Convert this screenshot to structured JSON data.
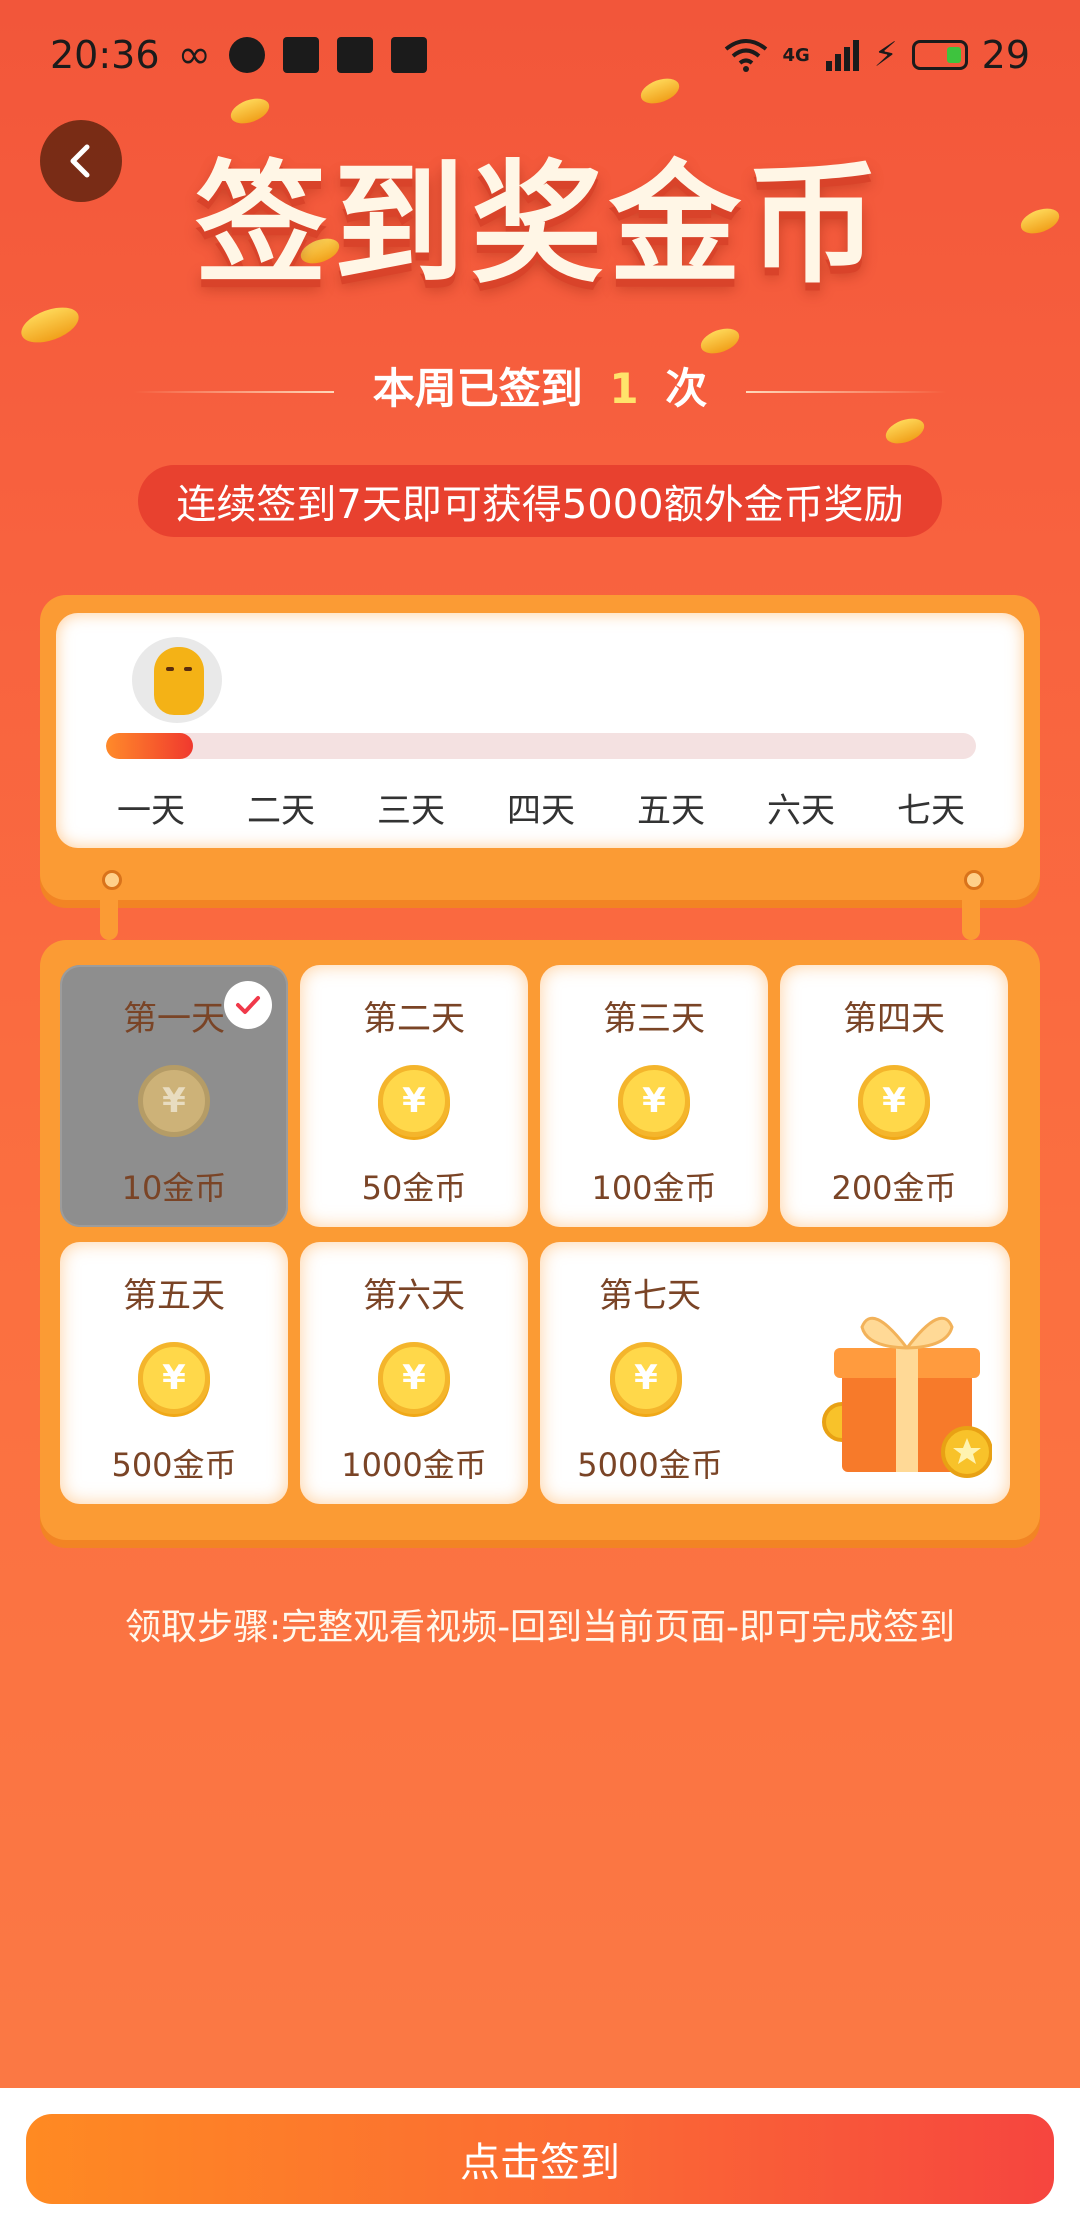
{
  "status_bar": {
    "time": "20:36",
    "network": "4G",
    "battery": "29"
  },
  "header": {
    "title": "签到奖金币"
  },
  "weekly": {
    "prefix": "本周已签到",
    "count": "1",
    "suffix": "次"
  },
  "bonus_banner": "连续签到7天即可获得5000额外金币奖励",
  "progress": {
    "fraction": 0.1,
    "days": [
      "一天",
      "二天",
      "三天",
      "四天",
      "五天",
      "六天",
      "七天"
    ]
  },
  "rewards": [
    {
      "day": "第一天",
      "amount": "10金币",
      "signed": true
    },
    {
      "day": "第二天",
      "amount": "50金币",
      "signed": false
    },
    {
      "day": "第三天",
      "amount": "100金币",
      "signed": false
    },
    {
      "day": "第四天",
      "amount": "200金币",
      "signed": false
    },
    {
      "day": "第五天",
      "amount": "500金币",
      "signed": false
    },
    {
      "day": "第六天",
      "amount": "1000金币",
      "signed": false
    },
    {
      "day": "第七天",
      "amount": "5000金币",
      "signed": false
    }
  ],
  "coin_symbol": "¥",
  "instructions": "领取步骤:完整观看视频-回到当前页面-即可完成签到",
  "action_button": "点击签到",
  "colors": {
    "accent_orange": "#fb9b34",
    "button_gradient_start": "#ff8a22",
    "button_gradient_end": "#f6453f",
    "count_highlight": "#ffe36b"
  }
}
